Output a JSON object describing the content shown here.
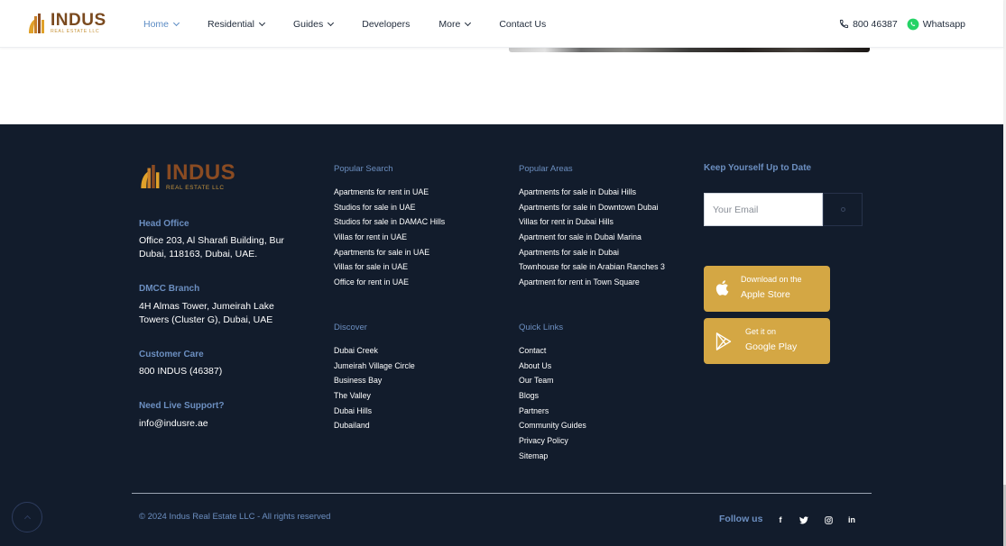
{
  "brand": {
    "name": "INDUS",
    "subtitle": "REAL ESTATE LLC"
  },
  "nav": [
    {
      "label": "Home",
      "dropdown": true,
      "active": true
    },
    {
      "label": "Residential",
      "dropdown": true
    },
    {
      "label": "Guides",
      "dropdown": true
    },
    {
      "label": "Developers",
      "dropdown": false
    },
    {
      "label": "More",
      "dropdown": true
    },
    {
      "label": "Contact Us",
      "dropdown": false
    }
  ],
  "header_right": {
    "phone": "800 46387",
    "whatsapp": "Whatsapp"
  },
  "offices": [
    {
      "heading": "Head Office",
      "text": [
        "Office 203, Al Sharafi Building, Bur",
        "Dubai, 118163, Dubai, UAE."
      ]
    },
    {
      "heading": "DMCC Branch",
      "text": [
        "4H Almas Tower, Jumeirah Lake",
        "Towers (Cluster G), Dubai, UAE"
      ]
    },
    {
      "heading": "Customer Care",
      "text": [
        "800 INDUS (46387)"
      ]
    },
    {
      "heading": "Need Live Support?",
      "text": [
        "info@indusre.ae"
      ]
    }
  ],
  "popular_search": {
    "title": "Popular Search",
    "items": [
      "Apartments for rent in UAE",
      "Studios for sale in UAE",
      "Studios for sale in DAMAC Hills",
      "Villas for rent in UAE",
      "Apartments for sale in UAE",
      "Villas for sale in UAE",
      "Office for rent in UAE"
    ]
  },
  "popular_areas": {
    "title": "Popular Areas",
    "items": [
      "Apartments for sale in Dubai Hills",
      "Apartments for sale in Downtown Dubai",
      "Villas for rent in Dubai Hills",
      "Apartment for sale in Dubai Marina",
      "Apartments for sale in Dubai",
      "Townhouse for sale in Arabian Ranches 3",
      "Apartment for rent in Town Square"
    ]
  },
  "discover": {
    "title": "Discover",
    "items": [
      "Dubai Creek",
      "Jumeirah Village Circle",
      "Business Bay",
      "The Valley",
      "Dubai Hills",
      "Dubailand"
    ]
  },
  "quick_links": {
    "title": "Quick Links",
    "items": [
      "Contact",
      "About Us",
      "Our Team",
      "Blogs",
      "Partners",
      "Community Guides",
      "Privacy Policy",
      "Sitemap"
    ]
  },
  "newsletter": {
    "title": "Keep Yourself Up to Date",
    "placeholder": "Your Email"
  },
  "apps": [
    {
      "small": "Download on the",
      "big": "Apple Store",
      "icon": "apple-icon"
    },
    {
      "small": "Get it on",
      "big": "Google Play",
      "icon": "google-play-icon"
    }
  ],
  "copyright": "© 2024 Indus Real Estate LLC - All rights reserved",
  "follow_label": "Follow us",
  "social": [
    {
      "label": "f",
      "icon": "facebook-icon"
    },
    {
      "label": "♥",
      "icon": "twitter-icon"
    },
    {
      "label": "◎",
      "icon": "instagram-icon"
    },
    {
      "label": "in",
      "icon": "linkedin-icon"
    }
  ],
  "colors": {
    "footer_bg": "#121c2c",
    "accent_blue": "#6c8fc1",
    "gold": "#d4a744",
    "brand_brown": "#7a4a1f"
  }
}
